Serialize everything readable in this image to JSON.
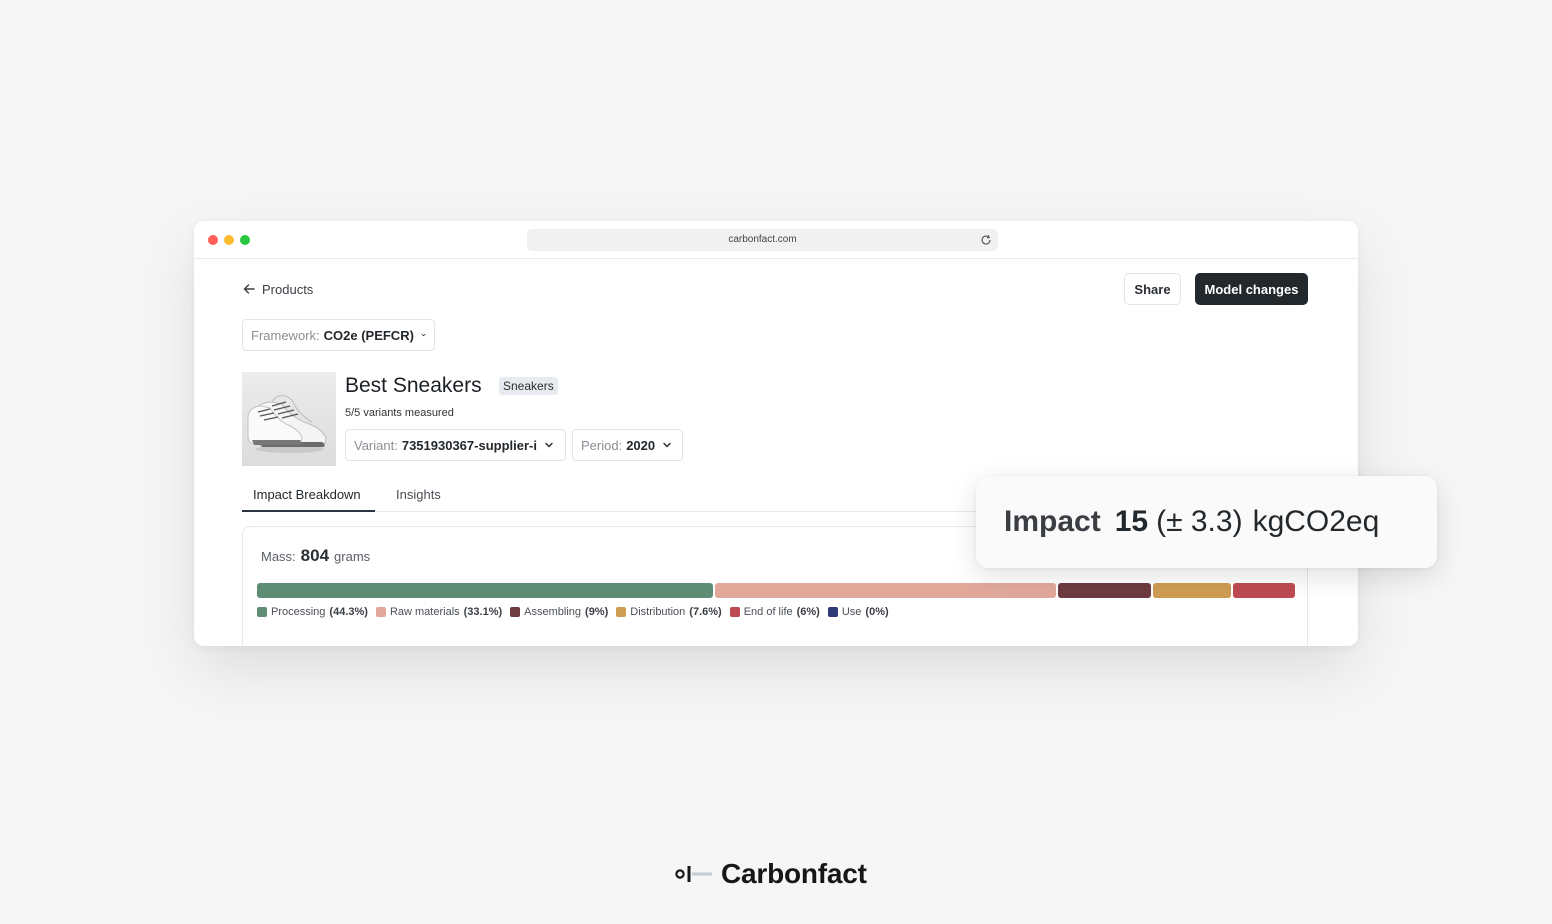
{
  "browser": {
    "url": "carbonfact.com"
  },
  "header": {
    "back_label": "Products",
    "share_label": "Share",
    "model_changes_label": "Model changes"
  },
  "framework": {
    "label": "Framework:",
    "value": "CO2e (PEFCR)"
  },
  "product": {
    "title": "Best Sneakers",
    "category": "Sneakers",
    "variants_measured": "5/5 variants measured",
    "variant_label": "Variant:",
    "variant_value": "7351930367-supplier-i",
    "period_label": "Period:",
    "period_value": "2020"
  },
  "tabs": [
    {
      "label": "Impact Breakdown"
    },
    {
      "label": "Insights"
    }
  ],
  "mass": {
    "label": "Mass:",
    "value": "804",
    "unit": "grams"
  },
  "breakdown": [
    {
      "name": "Processing",
      "pct": "(44.3%)",
      "value": 44.3,
      "color": "#5f8c74"
    },
    {
      "name": "Raw materials",
      "pct": "(33.1%)",
      "value": 33.1,
      "color": "#e2a99b"
    },
    {
      "name": "Assembling",
      "pct": "(9%)",
      "value": 9,
      "color": "#6e3b40"
    },
    {
      "name": "Distribution",
      "pct": "(7.6%)",
      "value": 7.6,
      "color": "#cf9d52"
    },
    {
      "name": "End of life",
      "pct": "(6%)",
      "value": 6,
      "color": "#bf4b52"
    },
    {
      "name": "Use",
      "pct": "(0%)",
      "value": 0,
      "color": "#2f3b78"
    }
  ],
  "impact": {
    "label": "Impact",
    "value": "15",
    "uncertainty": "(± 3.3)",
    "unit": "kgCO2eq"
  },
  "brand": {
    "name": "Carbonfact"
  }
}
